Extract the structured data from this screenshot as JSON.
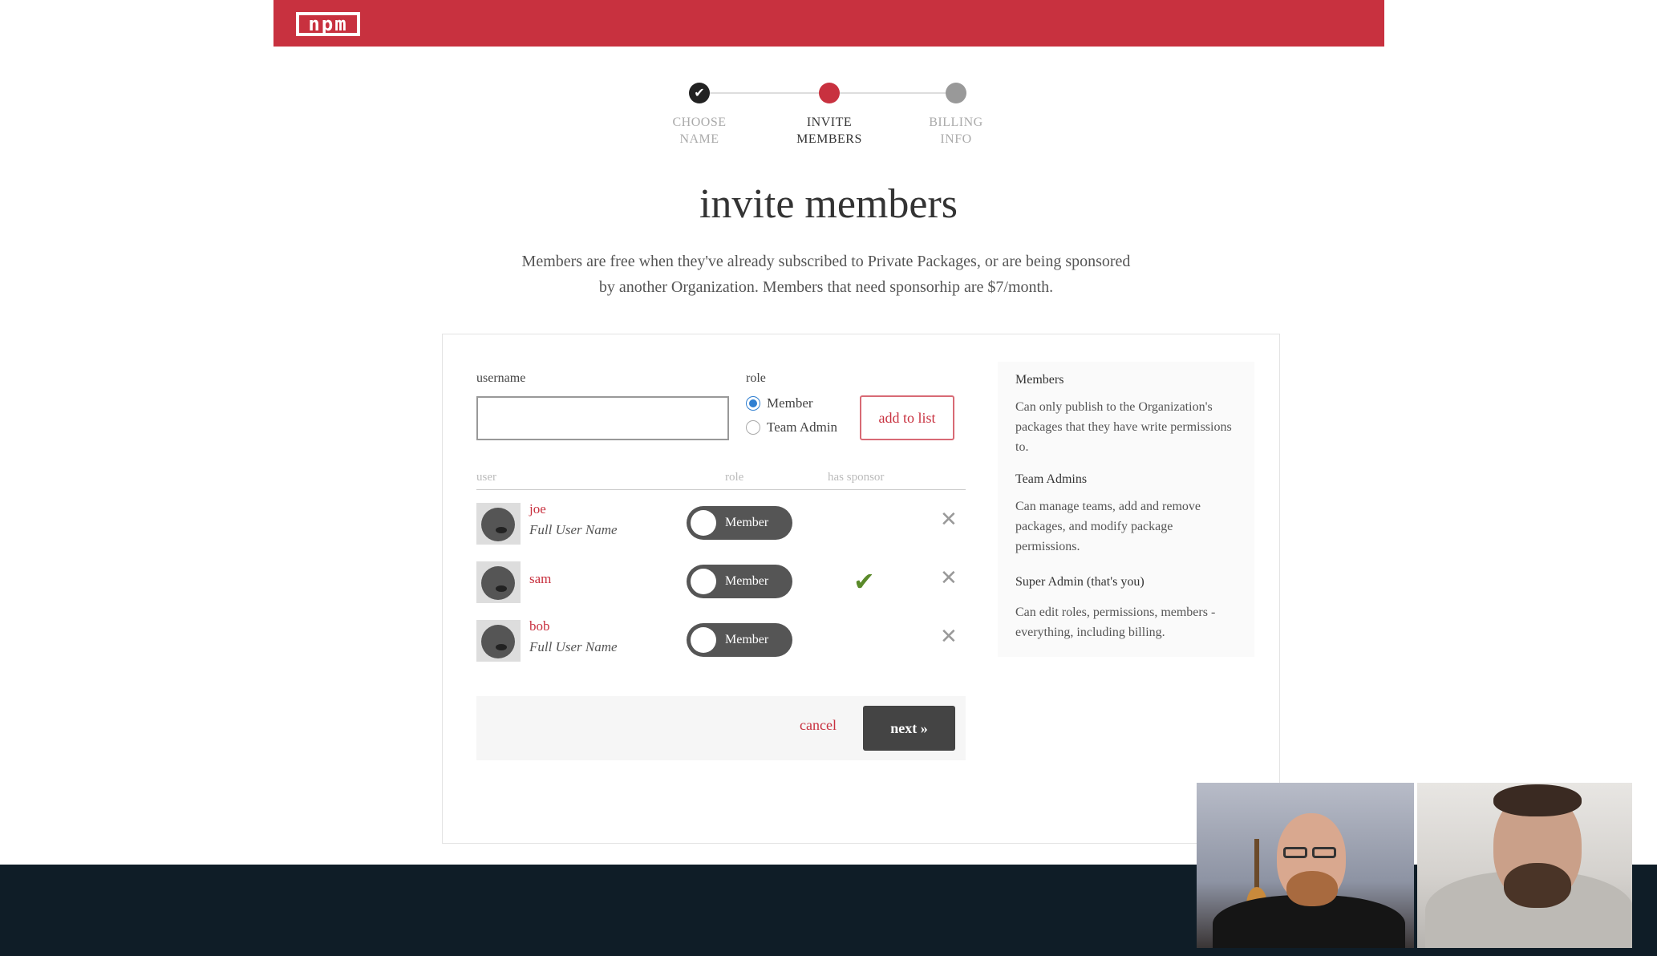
{
  "brand": {
    "logo_text": "npm",
    "color": "#c8313f"
  },
  "stepper": {
    "steps": [
      {
        "label_line1": "CHOOSE",
        "label_line2": "NAME",
        "state": "complete",
        "icon": "check-icon"
      },
      {
        "label_line1": "INVITE",
        "label_line2": "MEMBERS",
        "state": "active"
      },
      {
        "label_line1": "BILLING",
        "label_line2": "INFO",
        "state": "upcoming"
      }
    ]
  },
  "page": {
    "title": "invite members",
    "description": "Members are free when they've already subscribed to Private Packages, or are being sponsored by another Organization. Members that need sponsorhip are $7/month."
  },
  "form": {
    "username_label": "username",
    "username_value": "",
    "role_label": "role",
    "roles": [
      {
        "label": "Member",
        "checked": true
      },
      {
        "label": "Team Admin",
        "checked": false
      }
    ],
    "add_button": "add to list"
  },
  "table": {
    "headers": {
      "user": "user",
      "role": "role",
      "sponsor": "has sponsor"
    },
    "rows": [
      {
        "username": "joe",
        "full_name": "Full User Name",
        "role": "Member",
        "has_sponsor": false
      },
      {
        "username": "sam",
        "full_name": "",
        "role": "Member",
        "has_sponsor": true
      },
      {
        "username": "bob",
        "full_name": "Full User Name",
        "role": "Member",
        "has_sponsor": false
      }
    ]
  },
  "actions": {
    "cancel": "cancel",
    "next": "next »"
  },
  "help": {
    "sections": [
      {
        "title": "Members",
        "text": "Can only publish to the Organization's packages that they have write permissions to."
      },
      {
        "title": "Team Admins",
        "text": "Can manage teams, add and remove packages, and modify package permissions."
      },
      {
        "title": "Super Admin (that's you)",
        "text": "Can edit roles, permissions, members - everything, including billing."
      }
    ]
  }
}
